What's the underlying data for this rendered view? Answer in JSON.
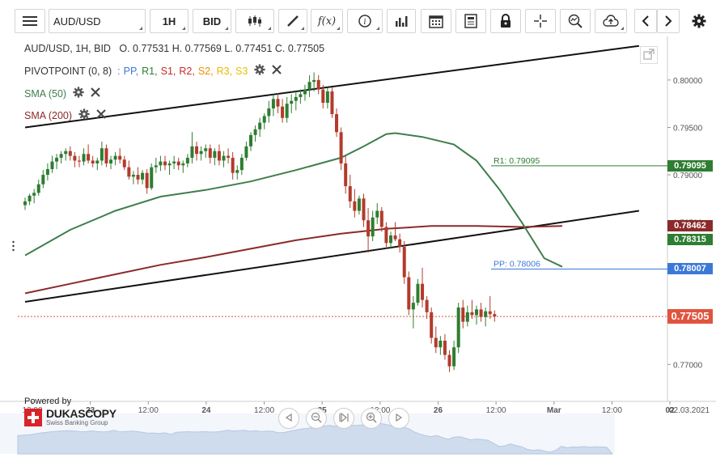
{
  "toolbar": {
    "symbol": "AUD/USD",
    "timeframe": "1H",
    "side": "BID",
    "icons": [
      "menu-icon",
      "candlestick-icon",
      "draw-icon",
      "function-icon",
      "info-icon",
      "volume-icon",
      "calendar-icon",
      "news-icon",
      "lock-icon",
      "crosshair-icon",
      "zoom-icon",
      "upload-icon",
      "prev-icon",
      "next-icon",
      "settings-icon"
    ],
    "function_label": "f(x)"
  },
  "legend": {
    "ohlc": "AUD/USD, 1H, BID   O. 0.77531 H. 0.77569 L. 0.77451 C. 0.77505",
    "pivot_label": "PIVOTPOINT (0, 8)",
    "pivot_sep": ":",
    "pivot_items": [
      {
        "text": "PP,",
        "color": "#3c78d8"
      },
      {
        "text": "R1,",
        "color": "#2e7d32"
      },
      {
        "text": "S1,",
        "color": "#c62828"
      },
      {
        "text": "R2,",
        "color": "#c62828"
      },
      {
        "text": "S2,",
        "color": "#ef8c00"
      },
      {
        "text": "R3,",
        "color": "#e6b800"
      },
      {
        "text": "S3",
        "color": "#e6c200"
      }
    ],
    "sma50": "SMA (50)",
    "sma200": "SMA (200)"
  },
  "branding": {
    "powered_by": "Powered by",
    "name": "DUKASCOPY",
    "tagline": "Swiss Banking Group"
  },
  "colors": {
    "bull": "#2e7d32",
    "bear": "#b23b2c",
    "sma50": "#3e7e4c",
    "sma200": "#8b2a2a",
    "channel": "#111111",
    "pp": "#3c78d8",
    "r1": "#2e7d32",
    "price": "#e0543e"
  },
  "chart_data": {
    "type": "candlestick",
    "symbol": "AUD/USD",
    "interval": "1H",
    "ohlc": {
      "open": 0.77531,
      "high": 0.77569,
      "low": 0.77451,
      "close": 0.77505
    },
    "y_ticks": [
      0.8,
      0.795,
      0.79,
      0.785,
      0.78,
      0.775,
      0.77
    ],
    "y_tick_labels": [
      "0.80000",
      "0.79500",
      "0.79000",
      "0.78500",
      "0.78000",
      "0.77500",
      "0.77000"
    ],
    "ylim": [
      0.7661,
      0.8046
    ],
    "x_range_hours": [
      0,
      136
    ],
    "x_ticks": [
      {
        "label": "12:00",
        "hour": 0,
        "bold": false
      },
      {
        "label": "23",
        "hour": 12,
        "bold": true
      },
      {
        "label": "12:00",
        "hour": 24,
        "bold": false
      },
      {
        "label": "24",
        "hour": 36,
        "bold": true
      },
      {
        "label": "12:00",
        "hour": 48,
        "bold": false
      },
      {
        "label": "25",
        "hour": 60,
        "bold": true
      },
      {
        "label": "12:00",
        "hour": 72,
        "bold": false
      },
      {
        "label": "26",
        "hour": 84,
        "bold": true
      },
      {
        "label": "12:00",
        "hour": 96,
        "bold": false
      },
      {
        "label": "Mar",
        "hour": 108,
        "bold": true
      },
      {
        "label": "12:00",
        "hour": 120,
        "bold": false
      },
      {
        "label": "02",
        "hour": 132,
        "bold": true
      },
      {
        "label": "12:00",
        "hour": 144,
        "bold": false
      }
    ],
    "date_stamp": "02.03.2021",
    "candles": [
      [
        0.7868,
        0.7876,
        0.7863,
        0.7872
      ],
      [
        0.7872,
        0.788,
        0.7868,
        0.7878
      ],
      [
        0.7878,
        0.7885,
        0.787,
        0.7881
      ],
      [
        0.7881,
        0.7895,
        0.7878,
        0.789
      ],
      [
        0.789,
        0.7905,
        0.7886,
        0.79
      ],
      [
        0.79,
        0.7912,
        0.7894,
        0.7906
      ],
      [
        0.7906,
        0.792,
        0.7902,
        0.7914
      ],
      [
        0.7914,
        0.7922,
        0.7906,
        0.7918
      ],
      [
        0.7918,
        0.7925,
        0.7912,
        0.7922
      ],
      [
        0.7922,
        0.7928,
        0.7915,
        0.7925
      ],
      [
        0.7925,
        0.793,
        0.7915,
        0.792
      ],
      [
        0.792,
        0.7924,
        0.7908,
        0.7915
      ],
      [
        0.7915,
        0.792,
        0.7908,
        0.7914
      ],
      [
        0.7914,
        0.7928,
        0.791,
        0.7922
      ],
      [
        0.7922,
        0.7932,
        0.7912,
        0.7915
      ],
      [
        0.7915,
        0.792,
        0.7908,
        0.7912
      ],
      [
        0.7912,
        0.7918,
        0.7905,
        0.7915
      ],
      [
        0.7915,
        0.7935,
        0.791,
        0.7928
      ],
      [
        0.7928,
        0.7932,
        0.7908,
        0.7912
      ],
      [
        0.7912,
        0.792,
        0.7906,
        0.7916
      ],
      [
        0.7916,
        0.7924,
        0.791,
        0.792
      ],
      [
        0.792,
        0.7928,
        0.7912,
        0.7916
      ],
      [
        0.7916,
        0.792,
        0.7905,
        0.7908
      ],
      [
        0.7908,
        0.7915,
        0.7895,
        0.7898
      ],
      [
        0.7898,
        0.7904,
        0.789,
        0.79
      ],
      [
        0.79,
        0.7908,
        0.789,
        0.7895
      ],
      [
        0.7895,
        0.7905,
        0.789,
        0.7902
      ],
      [
        0.7902,
        0.7906,
        0.788,
        0.7886
      ],
      [
        0.7886,
        0.7912,
        0.7884,
        0.7908
      ],
      [
        0.7908,
        0.7918,
        0.7902,
        0.791
      ],
      [
        0.791,
        0.792,
        0.7904,
        0.7914
      ],
      [
        0.7914,
        0.792,
        0.7905,
        0.791
      ],
      [
        0.791,
        0.7915,
        0.79,
        0.7912
      ],
      [
        0.7912,
        0.792,
        0.7906,
        0.7914
      ],
      [
        0.7914,
        0.7918,
        0.7905,
        0.791
      ],
      [
        0.791,
        0.7915,
        0.7902,
        0.7912
      ],
      [
        0.7912,
        0.7922,
        0.7908,
        0.7918
      ],
      [
        0.7918,
        0.7945,
        0.7912,
        0.793
      ],
      [
        0.793,
        0.7935,
        0.7915,
        0.7922
      ],
      [
        0.7922,
        0.793,
        0.7915,
        0.7925
      ],
      [
        0.7925,
        0.7932,
        0.7918,
        0.7928
      ],
      [
        0.7928,
        0.7932,
        0.7912,
        0.7918
      ],
      [
        0.7918,
        0.7928,
        0.791,
        0.7925
      ],
      [
        0.7925,
        0.7932,
        0.791,
        0.7915
      ],
      [
        0.7915,
        0.7925,
        0.7908,
        0.792
      ],
      [
        0.792,
        0.7928,
        0.7912,
        0.7918
      ],
      [
        0.7918,
        0.7924,
        0.7895,
        0.7902
      ],
      [
        0.7902,
        0.791,
        0.7895,
        0.7905
      ],
      [
        0.7905,
        0.7922,
        0.79,
        0.7918
      ],
      [
        0.7918,
        0.7935,
        0.7915,
        0.793
      ],
      [
        0.793,
        0.7945,
        0.7925,
        0.7942
      ],
      [
        0.7942,
        0.7952,
        0.7935,
        0.7948
      ],
      [
        0.7948,
        0.796,
        0.794,
        0.7955
      ],
      [
        0.7955,
        0.7965,
        0.7948,
        0.7962
      ],
      [
        0.7962,
        0.7978,
        0.7955,
        0.797
      ],
      [
        0.797,
        0.7985,
        0.7962,
        0.798
      ],
      [
        0.798,
        0.7986,
        0.7965,
        0.7972
      ],
      [
        0.7972,
        0.798,
        0.7955,
        0.796
      ],
      [
        0.796,
        0.7982,
        0.7955,
        0.7975
      ],
      [
        0.7975,
        0.7985,
        0.7965,
        0.7978
      ],
      [
        0.7978,
        0.7988,
        0.7968,
        0.7982
      ],
      [
        0.7982,
        0.799,
        0.7975,
        0.7985
      ],
      [
        0.7985,
        0.7995,
        0.7978,
        0.799
      ],
      [
        0.799,
        0.8005,
        0.7982,
        0.7998
      ],
      [
        0.7998,
        0.8008,
        0.7988,
        0.8
      ],
      [
        0.8,
        0.8005,
        0.7985,
        0.799
      ],
      [
        0.799,
        0.7995,
        0.797,
        0.7976
      ],
      [
        0.7976,
        0.7992,
        0.797,
        0.7988
      ],
      [
        0.7988,
        0.7992,
        0.796,
        0.7964
      ],
      [
        0.7964,
        0.797,
        0.794,
        0.7945
      ],
      [
        0.7945,
        0.795,
        0.7905,
        0.7912
      ],
      [
        0.7912,
        0.792,
        0.788,
        0.7888
      ],
      [
        0.7888,
        0.79,
        0.7865,
        0.7872
      ],
      [
        0.7872,
        0.7885,
        0.7855,
        0.7862
      ],
      [
        0.7862,
        0.7878,
        0.7858,
        0.7875
      ],
      [
        0.7875,
        0.788,
        0.7845,
        0.7852
      ],
      [
        0.7852,
        0.7865,
        0.7818,
        0.7835
      ],
      [
        0.7835,
        0.7862,
        0.783,
        0.7855
      ],
      [
        0.7855,
        0.787,
        0.7848,
        0.7862
      ],
      [
        0.7862,
        0.7866,
        0.784,
        0.7845
      ],
      [
        0.7845,
        0.785,
        0.7822,
        0.7828
      ],
      [
        0.7828,
        0.784,
        0.7822,
        0.7836
      ],
      [
        0.7836,
        0.785,
        0.783,
        0.7832
      ],
      [
        0.7832,
        0.7838,
        0.7818,
        0.7824
      ],
      [
        0.7824,
        0.783,
        0.7785,
        0.7792
      ],
      [
        0.7792,
        0.7798,
        0.7752,
        0.7758
      ],
      [
        0.7758,
        0.7772,
        0.7738,
        0.7765
      ],
      [
        0.7765,
        0.779,
        0.7762,
        0.7785
      ],
      [
        0.7785,
        0.7802,
        0.776,
        0.7768
      ],
      [
        0.7768,
        0.7772,
        0.7748,
        0.7755
      ],
      [
        0.7755,
        0.776,
        0.7722,
        0.7728
      ],
      [
        0.7728,
        0.774,
        0.7712,
        0.7718
      ],
      [
        0.7718,
        0.773,
        0.771,
        0.7725
      ],
      [
        0.7725,
        0.7732,
        0.7705,
        0.771
      ],
      [
        0.771,
        0.7715,
        0.7692,
        0.7698
      ],
      [
        0.7698,
        0.7725,
        0.7694,
        0.7718
      ],
      [
        0.7718,
        0.7765,
        0.7712,
        0.776
      ],
      [
        0.776,
        0.7768,
        0.7738,
        0.7745
      ],
      [
        0.7745,
        0.7762,
        0.774,
        0.7755
      ],
      [
        0.7755,
        0.7768,
        0.7748,
        0.7752
      ],
      [
        0.7752,
        0.7762,
        0.7742,
        0.7758
      ],
      [
        0.7758,
        0.7765,
        0.7745,
        0.775
      ],
      [
        0.775,
        0.776,
        0.774,
        0.7756
      ],
      [
        0.7756,
        0.7772,
        0.7748,
        0.7753
      ],
      [
        0.7753,
        0.7757,
        0.7745,
        0.77505
      ]
    ],
    "sma50": [
      [
        0,
        0.7815
      ],
      [
        10,
        0.7842
      ],
      [
        20,
        0.7862
      ],
      [
        30,
        0.7877
      ],
      [
        40,
        0.7884
      ],
      [
        50,
        0.7893
      ],
      [
        60,
        0.7905
      ],
      [
        70,
        0.7918
      ],
      [
        75,
        0.793
      ],
      [
        80,
        0.7943
      ],
      [
        82,
        0.7944
      ],
      [
        88,
        0.794
      ],
      [
        95,
        0.7932
      ],
      [
        100,
        0.7915
      ],
      [
        105,
        0.7885
      ],
      [
        110,
        0.785
      ],
      [
        115,
        0.7812
      ],
      [
        119,
        0.7803
      ]
    ],
    "sma200": [
      [
        0,
        0.7775
      ],
      [
        10,
        0.7785
      ],
      [
        20,
        0.7795
      ],
      [
        30,
        0.7805
      ],
      [
        40,
        0.7813
      ],
      [
        50,
        0.7822
      ],
      [
        60,
        0.7831
      ],
      [
        70,
        0.7838
      ],
      [
        80,
        0.7843
      ],
      [
        90,
        0.7846
      ],
      [
        100,
        0.7846
      ],
      [
        110,
        0.7845
      ],
      [
        119,
        0.7846
      ]
    ],
    "channel_upper": [
      [
        0,
        0.795
      ],
      [
        136,
        0.8036
      ]
    ],
    "channel_lower": [
      [
        0,
        0.7766
      ],
      [
        136,
        0.7862
      ]
    ],
    "levels": [
      {
        "name": "R1",
        "label": "R1: 0.79095",
        "value": 0.79095,
        "badge": "0.79095"
      },
      {
        "name": "PP",
        "label": "PP: 0.78006",
        "value": 0.78006,
        "badge": "0.78007"
      }
    ],
    "badges": [
      {
        "value": 0.79095,
        "text": "0.79095",
        "color": "#2e7d32"
      },
      {
        "value": 0.78462,
        "text": "0.78462",
        "color": "#8b2a2a"
      },
      {
        "value": 0.78315,
        "text": "0.78315",
        "color": "#2e7d32"
      },
      {
        "value": 0.78006,
        "text": "0.78007",
        "color": "#3c78d8"
      },
      {
        "value": 0.77505,
        "text": "0.77505",
        "color": "#e0543e"
      }
    ],
    "current_price": 0.77505
  }
}
